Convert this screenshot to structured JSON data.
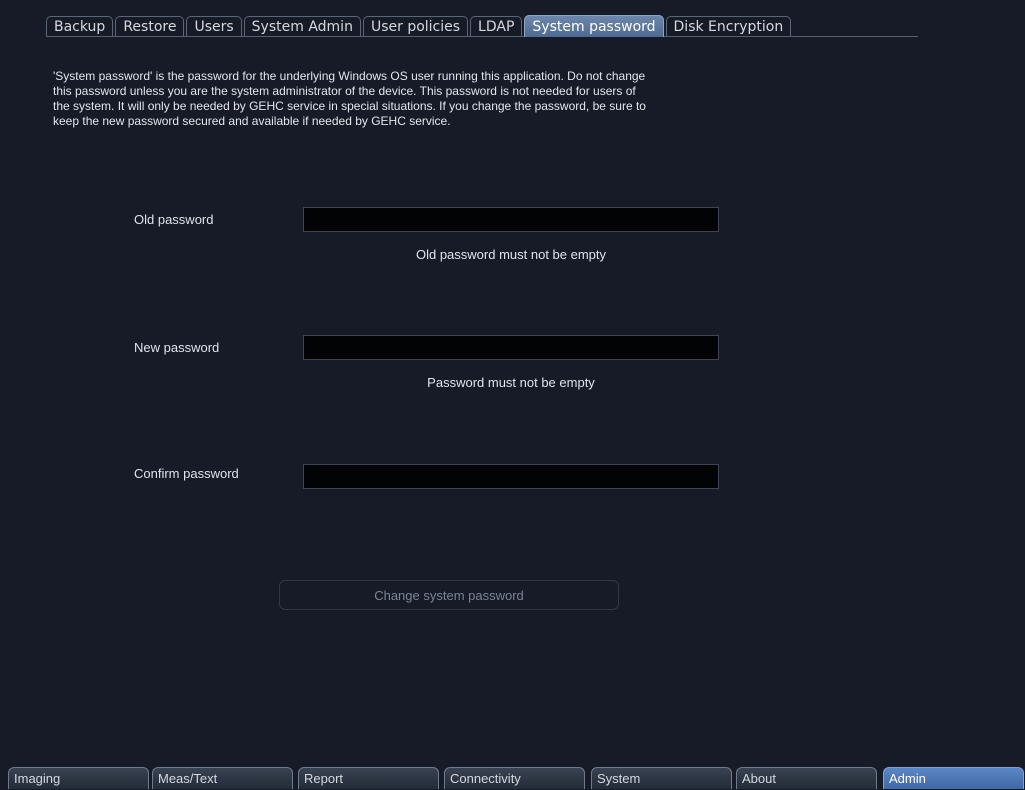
{
  "tabs": [
    {
      "label": "Backup"
    },
    {
      "label": "Restore"
    },
    {
      "label": "Users"
    },
    {
      "label": "System Admin"
    },
    {
      "label": "User policies"
    },
    {
      "label": "LDAP"
    },
    {
      "label": "System password",
      "active": true
    },
    {
      "label": "Disk Encryption"
    }
  ],
  "description": {
    "lines": [
      "'System password' is the password for the underlying Windows OS user running this application. Do not change",
      "this password unless you are the system administrator of the device. This password is not needed for users of",
      "the system. It will only be needed by GEHC service in special situations. If you change the password, be sure to",
      "keep the new password secured and available if needed by GEHC service."
    ]
  },
  "form": {
    "old_password": {
      "label": "Old password",
      "value": "",
      "hint": "Old password must not be empty"
    },
    "new_password": {
      "label": "New password",
      "value": "",
      "hint": "Password must not be empty"
    },
    "confirm_password": {
      "label": "Confirm password",
      "value": ""
    },
    "submit_label": "Change system password",
    "submit_enabled": false
  },
  "bottom_tabs": [
    {
      "label": "Imaging"
    },
    {
      "label": "Meas/Text"
    },
    {
      "label": "Report"
    },
    {
      "label": "Connectivity"
    },
    {
      "label": "System"
    },
    {
      "label": "About"
    },
    {
      "label": "Admin",
      "active": true
    }
  ],
  "colors": {
    "background": "#161b27",
    "active_tab": "#5b7aa5",
    "active_bottom_tab": "#4a74b3",
    "field_background": "#020305",
    "disabled_text": "#7c8594"
  }
}
